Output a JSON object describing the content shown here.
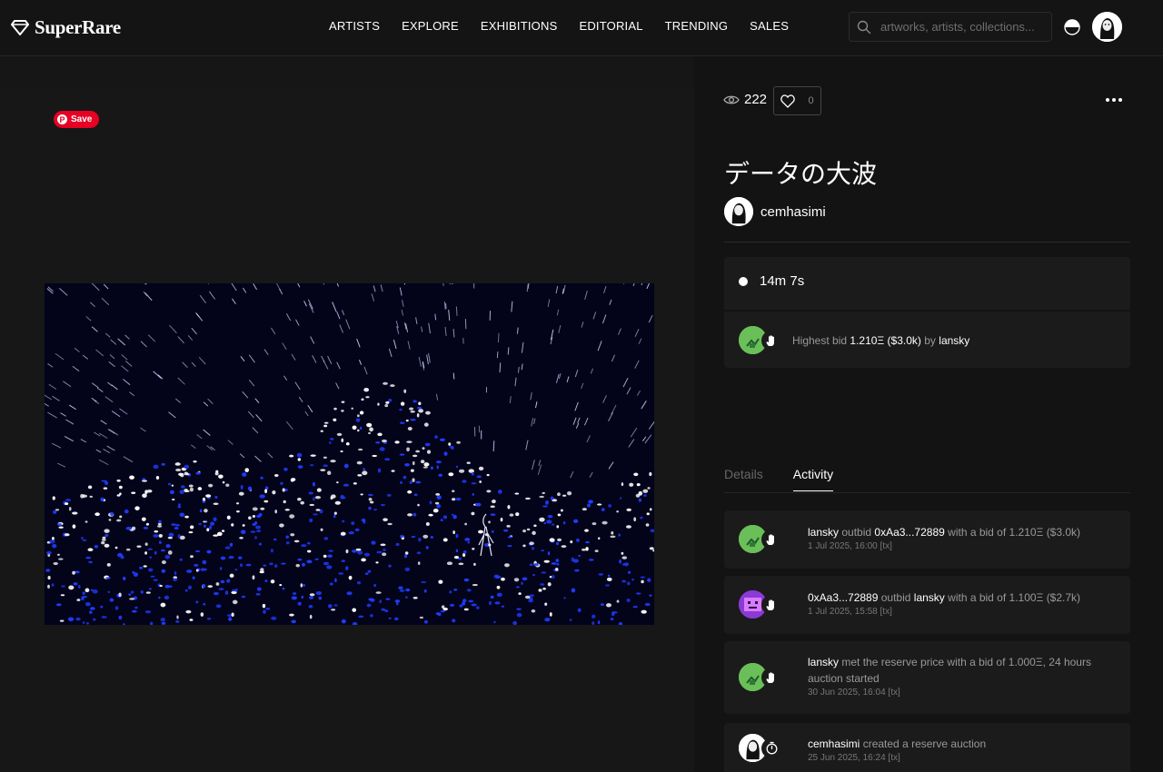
{
  "header": {
    "logo_text": "SuperRare",
    "nav": [
      "ARTISTS",
      "EXPLORE",
      "EXHIBITIONS",
      "EDITORIAL",
      "TRENDING",
      "SALES"
    ],
    "search_placeholder": "artworks, artists, collections..."
  },
  "artwork_panel": {
    "pin_save_label": "Save"
  },
  "stats": {
    "views": "222",
    "likes": "0"
  },
  "artwork": {
    "title": "データの大波",
    "artist": "cemhasimi"
  },
  "auction": {
    "time_left": "14m 7s",
    "highest_bid_prefix": "Highest bid",
    "highest_bid_amount": "1.210Ξ ($3.0k)",
    "highest_bid_by": "by",
    "highest_bidder": "lansky"
  },
  "tabs": [
    "Details",
    "Activity"
  ],
  "activity": [
    {
      "actor": "lansky",
      "verb": "outbid",
      "target": "0xAa3...72889",
      "rest": "with a bid of 1.210Ξ ($3.0k)",
      "date": "1 Jul 2025, 16:00",
      "link": "[tx]"
    },
    {
      "actor": "0xAa3...72889",
      "verb": "outbid",
      "target": "lansky",
      "rest": "with a bid of 1.100Ξ ($2.7k)",
      "date": "1 Jul 2025, 15:58",
      "link": "[tx]"
    },
    {
      "actor": "lansky",
      "rest": "met the reserve price with a bid of 1.000Ξ, 24 hours auction started",
      "date": "30 Jun 2025, 16:04",
      "link": "[tx]"
    },
    {
      "actor": "cemhasimi",
      "rest": "created a reserve auction",
      "date": "25 Jun 2025, 16:24",
      "link": "[tx]"
    }
  ],
  "colors": {
    "background": "#161616",
    "card": "#1b1b1b",
    "pinterest": "#e60023",
    "avatar_green": "#6bbf59",
    "avatar_purple": "#8b3ad6",
    "wave_blue": "#1f3cff"
  }
}
